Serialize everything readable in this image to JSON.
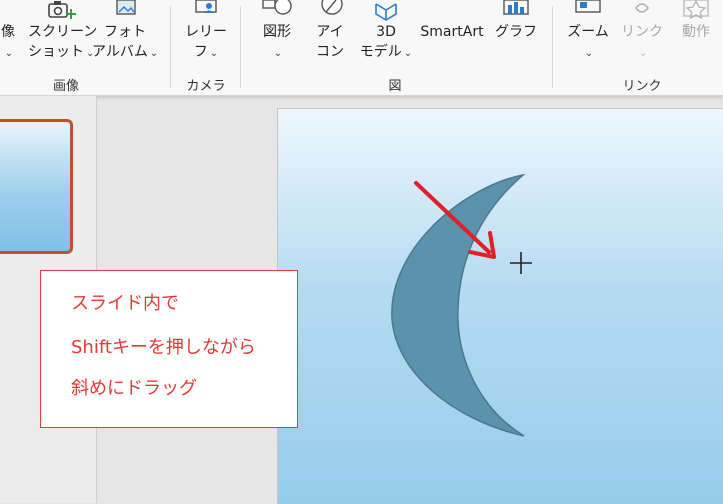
{
  "ribbon": {
    "groups": {
      "image": "画像",
      "camera": "カメラ",
      "illustrations": "図",
      "links": "リンク"
    },
    "buttons": {
      "image_partial": "像",
      "screenshot": [
        "スクリーン",
        "ショット"
      ],
      "photo_album": [
        "フォト",
        "アルバム"
      ],
      "cameo": [
        "レリー",
        "フ"
      ],
      "shapes": "図形",
      "icons": [
        "アイ",
        "コン"
      ],
      "models_3d": [
        "3D",
        "モデル"
      ],
      "smartart": "SmartArt",
      "chart": "グラフ",
      "zoom": "ズーム",
      "link": "リンク",
      "action": "動作"
    }
  },
  "callout": {
    "lines": [
      "スライド内で",
      "Shiftキーを押しながら",
      "斜めにドラッグ"
    ]
  },
  "colors": {
    "callout_text": "#e53935",
    "arrow": "#e0202a",
    "moon": "#5b93ad",
    "thumbnail_border": "#c0502b"
  }
}
